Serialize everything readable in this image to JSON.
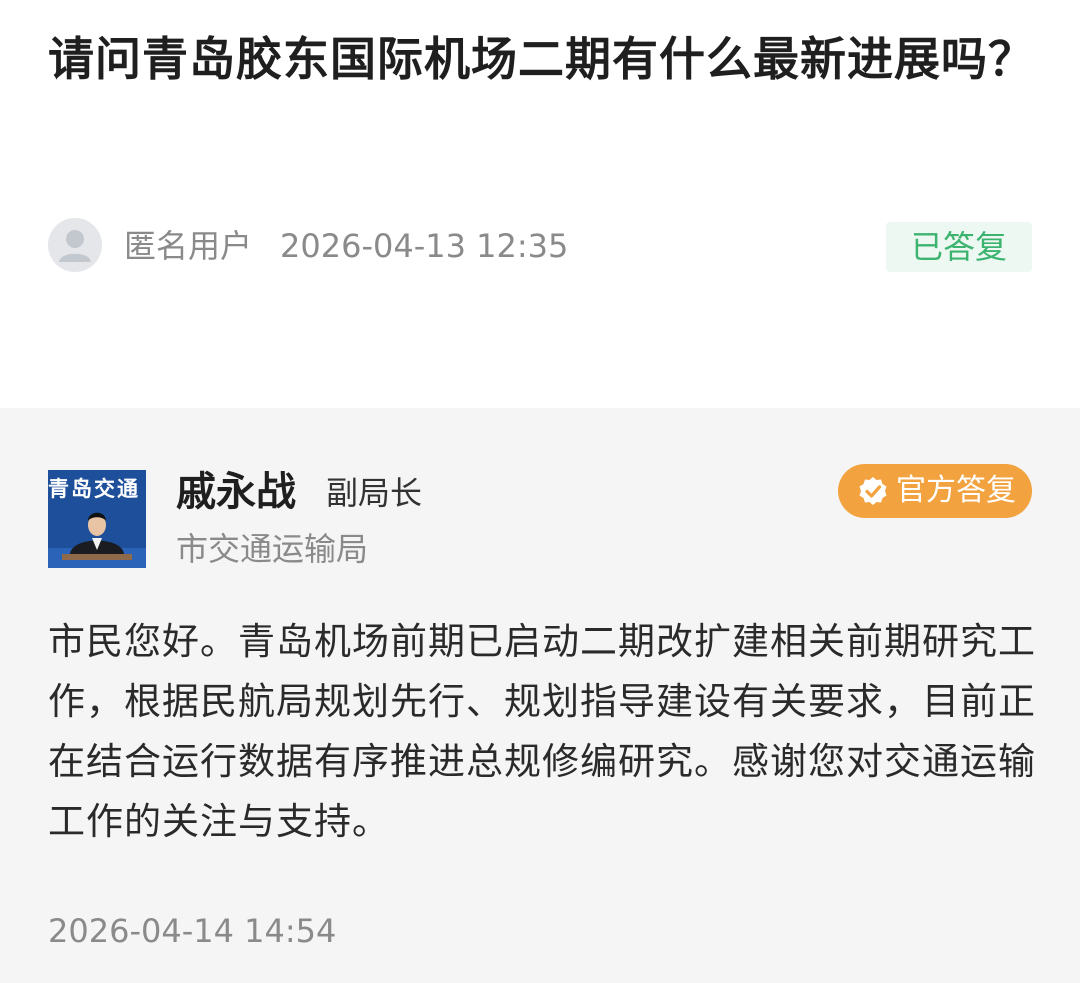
{
  "question": {
    "title": "请问青岛胶东国际机场二期有什么最新进展吗？",
    "asker_name": "匿名用户",
    "asker_time": "2026-04-13 12:35",
    "status": "已答复",
    "status_color": "#3cb46f"
  },
  "answer": {
    "responder_name": "戚永战",
    "responder_title": "副局长",
    "responder_dept": "市交通运输局",
    "photo_caption": "青岛交通",
    "official_badge": "官方答复",
    "badge_color": "#f2a23f",
    "body": "市民您好。青岛机场前期已启动二期改扩建相关前期研究工作，根据民航局规划先行、规划指导建设有关要求，目前正在结合运行数据有序推进总规修编研究。感谢您对交通运输工作的关注与支持。",
    "time": "2026-04-14 14:54"
  },
  "icons": {
    "asker_avatar": "user-avatar-icon",
    "official_badge": "check-badge-icon"
  }
}
